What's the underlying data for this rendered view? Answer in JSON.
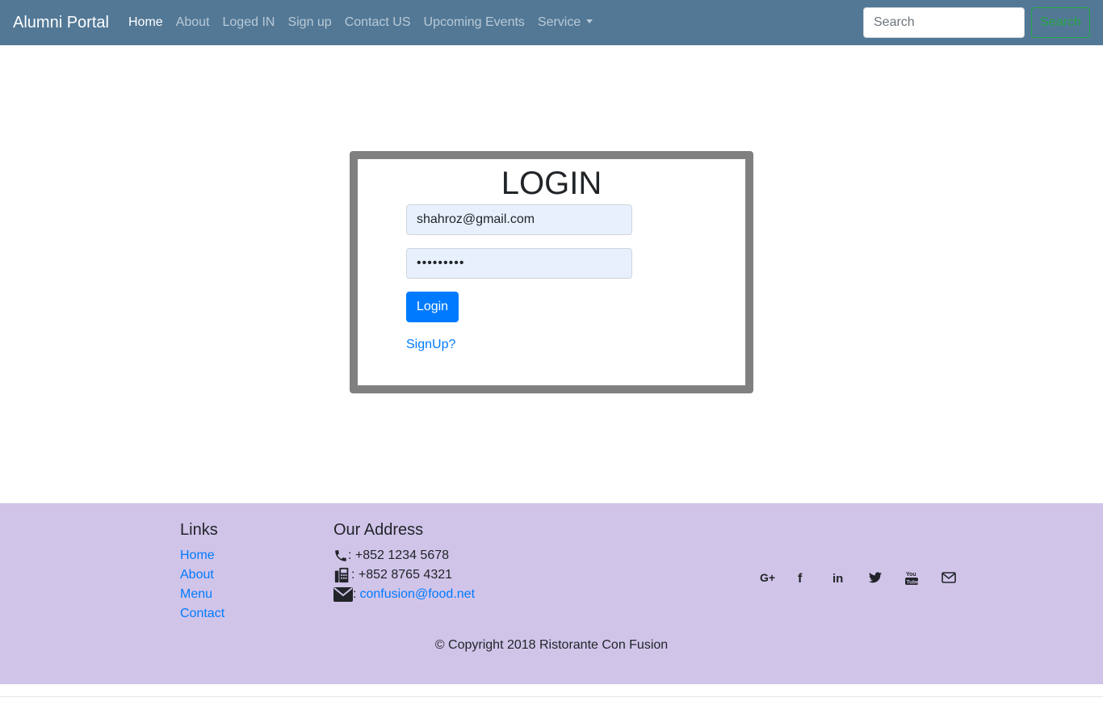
{
  "navbar": {
    "brand": "Alumni Portal",
    "links": [
      "Home",
      "About",
      "Loged IN",
      "Sign up",
      "Contact US",
      "Upcoming Events",
      "Service"
    ],
    "search_placeholder": "Search",
    "search_button": "Search"
  },
  "login": {
    "title": "LOGIN",
    "email_value": "shahroz@gmail.com",
    "password_value": "•••••••••",
    "login_button": "Login",
    "signup_link": "SignUp?"
  },
  "footer": {
    "links_title": "Links",
    "links": [
      "Home",
      "About",
      "Menu",
      "Contact"
    ],
    "address_title": "Our Address",
    "phone": ": +852 1234 5678",
    "fax": ": +852 8765 4321",
    "email_prefix": ":",
    "email": "confusion@food.net",
    "social_icons": [
      "google-plus-icon",
      "facebook-icon",
      "linkedin-icon",
      "twitter-icon",
      "youtube-icon",
      "mail-icon"
    ],
    "copyright": "© Copyright 2018 Ristorante Con Fusion"
  }
}
